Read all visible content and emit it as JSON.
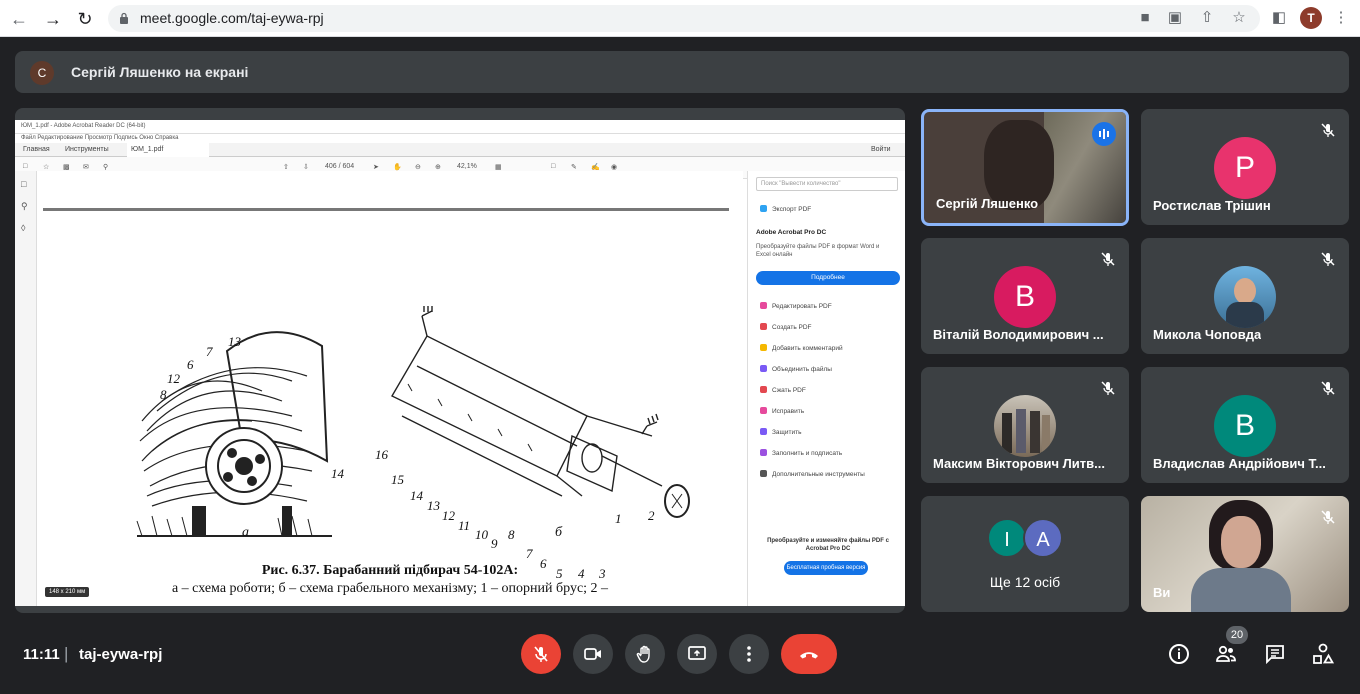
{
  "browser": {
    "url": "meet.google.com/taj-eywa-rpj",
    "profile_initial": "T"
  },
  "banner": {
    "avatar_initial": "С",
    "text": "Сергій Ляшенко на екрані"
  },
  "shared_screen": {
    "window_title": "ЮМ_1.pdf - Adobe Acrobat Reader DC (64-bit)",
    "menu": "Файл  Редактирование  Просмотр  Подпись  Окно  Справка",
    "tabs": [
      "Главная",
      "Инструменты",
      "ЮМ_1.pdf"
    ],
    "signin": "Войти",
    "page_counter": "406 / 604",
    "zoom": "42,1%",
    "search_placeholder": "Поиск \"Вывести количество\"",
    "pane_export": "Экспорт PDF",
    "pane_product": "Adobe Acrobat Pro DC",
    "pane_desc": "Преобразуйте файлы PDF в формат Word и Excel онлайн",
    "pane_more_btn": "Подробнее",
    "pane_tools": [
      "Редактировать PDF",
      "Создать PDF",
      "Добавить комментарий",
      "Объединить файлы",
      "Сжать PDF",
      "Исправить",
      "Защитить",
      "Заполнить и подписать",
      "Дополнительные инструменты"
    ],
    "pane_promo": "Преобразуйте и изменяйте файлы PDF с Acrobat Pro DC",
    "pane_trial_btn": "Бесплатная пробная версия",
    "page_size": "148 x 210 мм",
    "figure": {
      "caption_title": "Рис. 6.37. Барабанний підбирач 54-102А:",
      "caption_text": "а – схема роботи; б – схема грабельного механізму; 1 – опорний брус; 2 –",
      "label_a": "а",
      "label_b": "б",
      "numbers_left": [
        "13",
        "7",
        "6",
        "12",
        "8",
        "14"
      ],
      "numbers_right": [
        "16",
        "15",
        "14",
        "13",
        "12",
        "11",
        "10",
        "9",
        "8",
        "7",
        "6",
        "5",
        "4",
        "3",
        "2",
        "1"
      ]
    }
  },
  "participants": [
    {
      "name": "Сергій Ляшенко",
      "type": "video",
      "speaking": true
    },
    {
      "name": "Ростислав Трішин",
      "initial": "Р",
      "color": "#e8336d",
      "muted": true
    },
    {
      "name": "Віталій Володимирович ...",
      "initial": "В",
      "color": "#d81b60",
      "muted": true
    },
    {
      "name": "Микола Чоповда",
      "type": "photo",
      "muted": true
    },
    {
      "name": "Максим Вікторович Литв...",
      "type": "photo",
      "muted": true
    },
    {
      "name": "Владислав Андрійович Т...",
      "initial": "В",
      "color": "#00897b",
      "muted": true
    },
    {
      "name": "Ще 12 осіб",
      "type": "overflow",
      "initials": [
        "І",
        "А"
      ]
    },
    {
      "name": "Ви",
      "type": "video",
      "muted": true
    }
  ],
  "bottom_bar": {
    "time": "11:11",
    "separator": "|",
    "meeting_code": "taj-eywa-rpj",
    "people_count": "20"
  }
}
